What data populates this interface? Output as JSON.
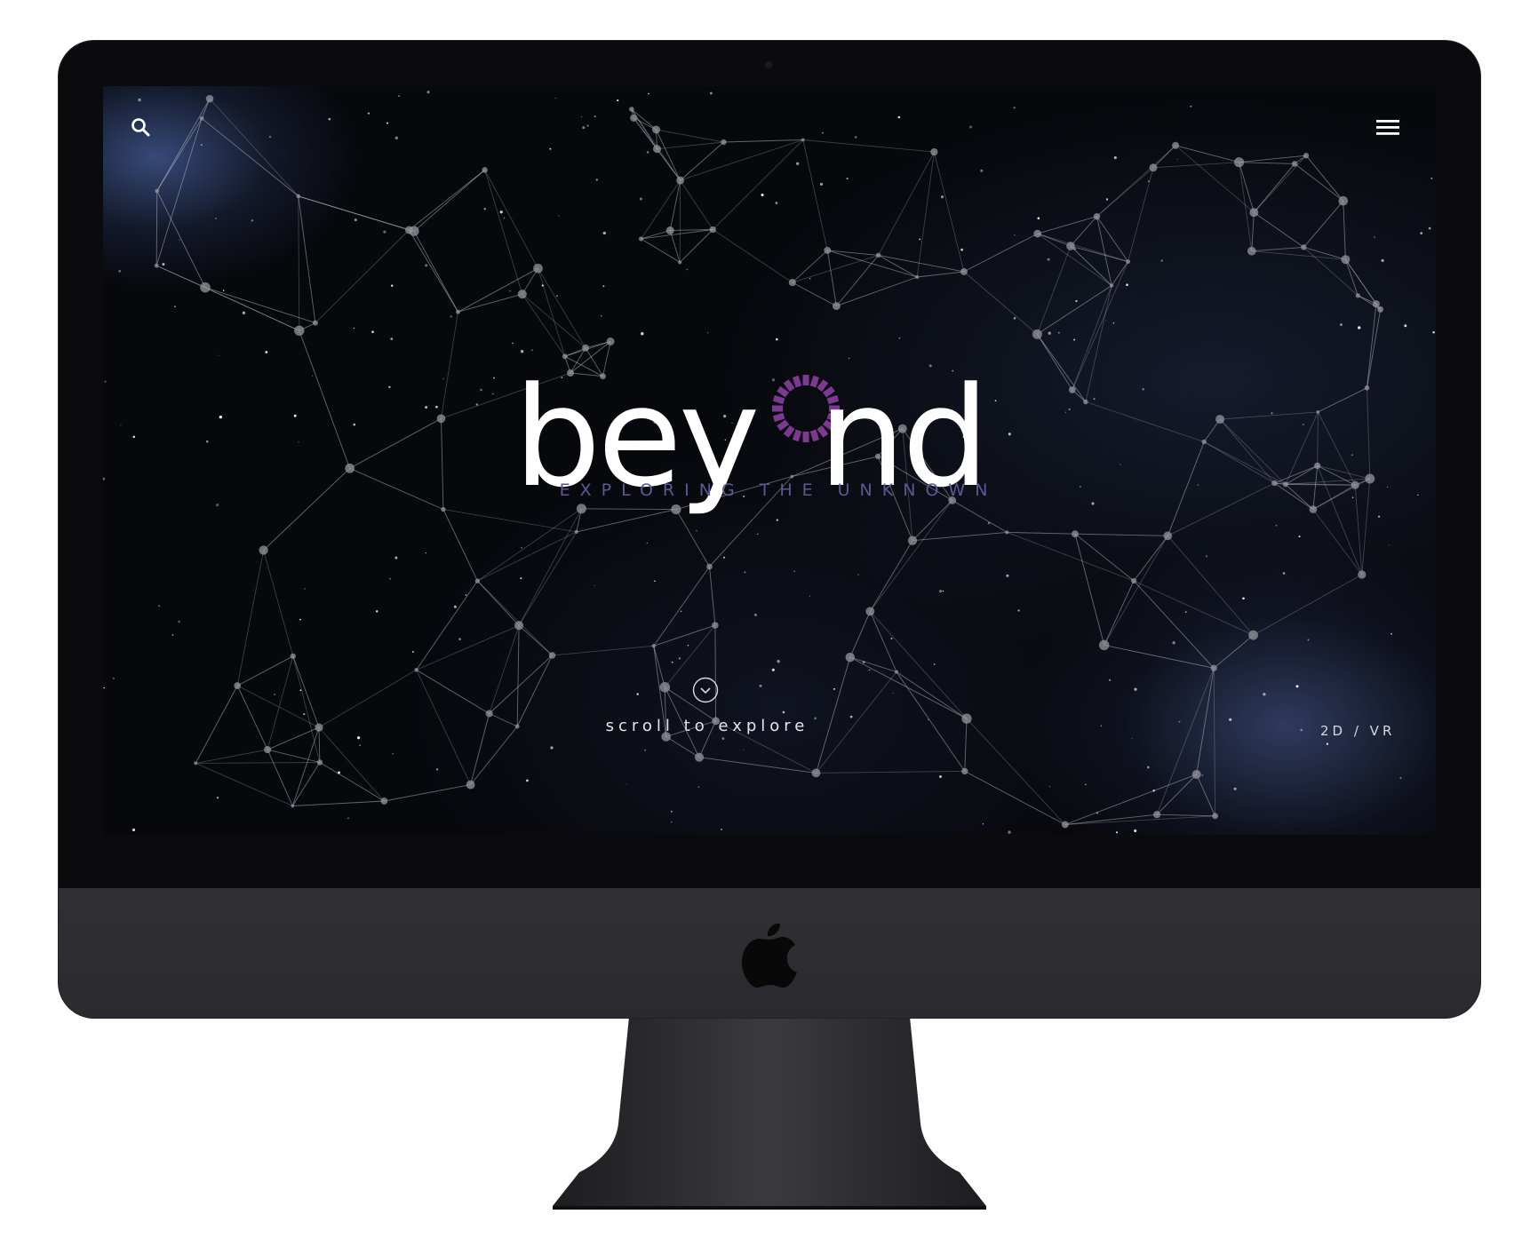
{
  "brand": {
    "logo_left": "bey",
    "logo_right": "nd",
    "logo_ring_color": "#7b3a8f",
    "tagline": "EXPLORING THE UNKNOWN",
    "tagline_color": "#5e5793"
  },
  "header": {
    "search_icon": "search-icon",
    "menu_icon": "hamburger-menu-icon"
  },
  "footer": {
    "scroll_label": "scroll to explore",
    "scroll_icon": "chevron-down-icon",
    "mode_toggle": "2D / VR"
  },
  "device": {
    "type": "iMac",
    "bezel_color": "#0b0b0d",
    "chin_color": "#2e2e32",
    "logo_icon": "apple-icon"
  }
}
